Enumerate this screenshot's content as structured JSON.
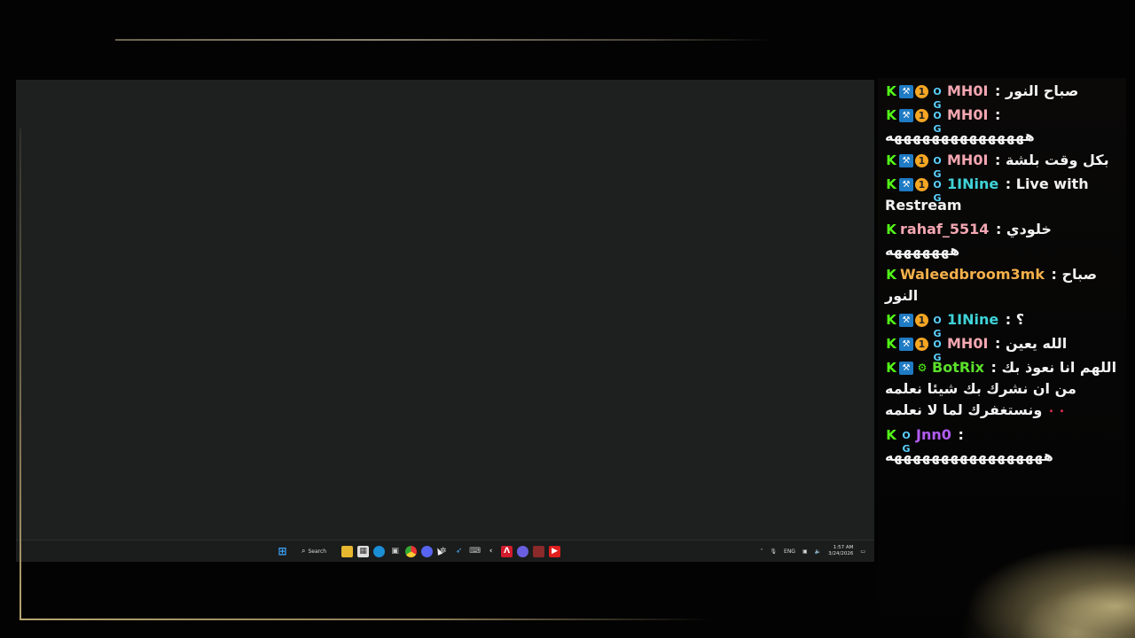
{
  "taskbar": {
    "search_label": "Search",
    "language": "ENG",
    "time": "1:57 AM",
    "date": "3/24/2026"
  },
  "chat": {
    "messages": [
      {
        "badges": [
          "k",
          "sub",
          "one",
          "og"
        ],
        "user": "MH0I",
        "user_color": "#f4a7b2",
        "text": "صباح النور"
      },
      {
        "badges": [
          "k",
          "sub",
          "one",
          "og"
        ],
        "user": "MH0I",
        "user_color": "#f4a7b2",
        "text": "هههههههههههههههه"
      },
      {
        "badges": [
          "k",
          "sub",
          "one",
          "og"
        ],
        "user": "MH0I",
        "user_color": "#f4a7b2",
        "text": "بكل وقت بلشة"
      },
      {
        "badges": [
          "k",
          "sub",
          "one",
          "og"
        ],
        "user": "1INine",
        "user_color": "#3fd3d8",
        "text": "Live with Restream"
      },
      {
        "badges": [
          "k"
        ],
        "user": "rahaf_5514",
        "user_color": "#f4a7b2",
        "text": "خلودي هههههههه"
      },
      {
        "badges": [
          "k"
        ],
        "user": "Waleedbroom3mk",
        "user_color": "#f5b04a",
        "text": "صباح النور"
      },
      {
        "badges": [
          "k",
          "sub",
          "one",
          "og"
        ],
        "user": "1INine",
        "user_color": "#3fd3d8",
        "text": "؟"
      },
      {
        "badges": [
          "k",
          "sub",
          "one",
          "og"
        ],
        "user": "MH0I",
        "user_color": "#f4a7b2",
        "text": "الله يعين"
      },
      {
        "badges": [
          "k",
          "sub",
          "bot"
        ],
        "user": "BotRix",
        "user_color": "#5be02b",
        "text": "اللهم انا نعوذ بك من ان نشرك بك شيئا نعلمه ونستغفرك لما لا نعلمه"
      },
      {
        "badges": [
          "k",
          "og"
        ],
        "user": "Jnn0",
        "user_color": "#b15cf0",
        "text": "هههههههههههههههههه"
      }
    ]
  }
}
